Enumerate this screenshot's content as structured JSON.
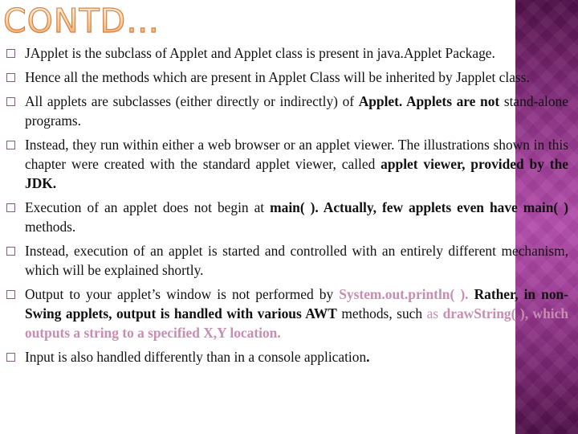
{
  "slide": {
    "title": "CONTD…",
    "theme": {
      "title_color": "#f6c08a",
      "title_outline": "#d4864a",
      "panel_color_dark": "#4f1048",
      "panel_color_light": "#b34cab",
      "highlight_text_color": "#c98db2",
      "bullet_color": "#8a5a88"
    },
    "bullets": [
      {
        "segments": [
          {
            "text": "JApplet is the subclass of Applet and Applet class is present in java.Applet Package.",
            "style": "normal"
          }
        ]
      },
      {
        "segments": [
          {
            "text": "Hence all the methods which are present in Applet Class will be inherited by Japplet class.",
            "style": "normal"
          }
        ]
      },
      {
        "segments": [
          {
            "text": "All applets are subclasses (either directly or indirectly) of ",
            "style": "normal"
          },
          {
            "text": "Applet. Applets are not",
            "style": "bold"
          },
          {
            "text": " stand-alone programs.",
            "style": "normal"
          }
        ]
      },
      {
        "segments": [
          {
            "text": "Instead, they run within either a web browser or an applet viewer. The illustrations shown in this chapter were created with the standard applet viewer, called ",
            "style": "normal"
          },
          {
            "text": "applet viewer, provided by the JDK.",
            "style": "bold"
          }
        ]
      },
      {
        "segments": [
          {
            "text": "Execution of an applet does not begin at ",
            "style": "normal"
          },
          {
            "text": "main( ). Actually, few applets even have main( )",
            "style": "bold"
          },
          {
            "text": " methods.",
            "style": "normal"
          }
        ]
      },
      {
        "segments": [
          {
            "text": "Instead, execution of an applet is started and controlled with an entirely different mechanism, which will be explained shortly.",
            "style": "normal"
          }
        ]
      },
      {
        "segments": [
          {
            "text": "Output to your applet’s window is not performed by ",
            "style": "normal"
          },
          {
            "text": "System.out.println( ).",
            "style": "highlight"
          },
          {
            "text": " Rather, in non-Swing applets, output is handled with various AWT",
            "style": "bold"
          },
          {
            "text": " methods, such ",
            "style": "normal"
          },
          {
            "text": "as",
            "style": "highlight-normal"
          },
          {
            "text": " drawString( ), which outputs a string to a specified X,Y location.",
            "style": "highlight"
          }
        ]
      },
      {
        "segments": [
          {
            "text": "Input is also handled differently than in a console application",
            "style": "normal"
          },
          {
            "text": ".",
            "style": "bold"
          }
        ]
      }
    ]
  }
}
